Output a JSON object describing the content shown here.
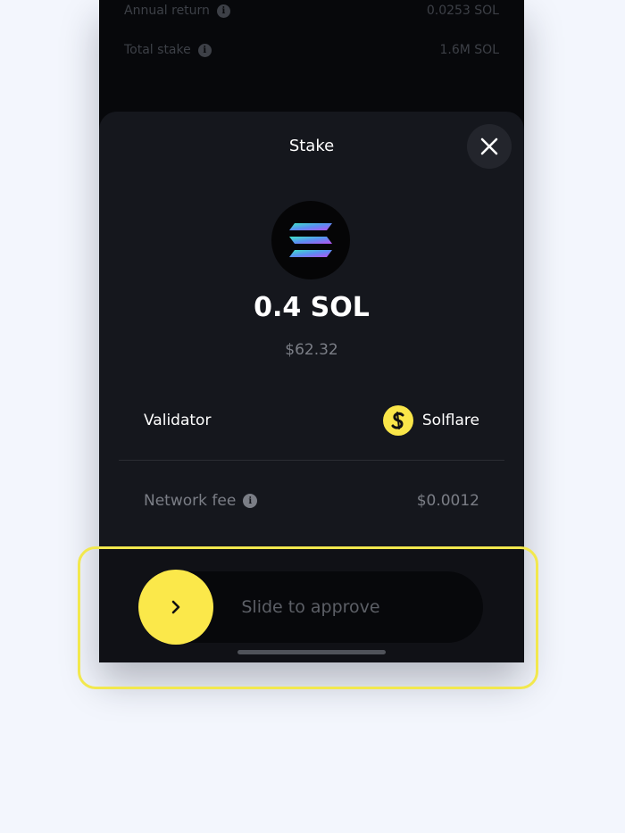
{
  "background_rows": [
    {
      "label": "Annual return",
      "value": "0.0253 SOL"
    },
    {
      "label": "Total stake",
      "value": "1.6M SOL"
    }
  ],
  "sheet": {
    "title": "Stake",
    "amount": "0.4 SOL",
    "usd_value": "$62.32",
    "validator_label": "Validator",
    "validator_name": "Solflare",
    "fee_label": "Network fee",
    "fee_value": "$0.0012"
  },
  "slider": {
    "label": "Slide to approve"
  },
  "icons": {
    "close": "close-icon",
    "info": "info-icon",
    "token": "solana-logo",
    "validator": "solflare-logo",
    "knob": "chevron-right-icon"
  },
  "colors": {
    "accent": "#fbe84a",
    "sheet_bg": "#15171d",
    "page_bg": "#f3f6fd",
    "highlight": "#f2e84e"
  }
}
